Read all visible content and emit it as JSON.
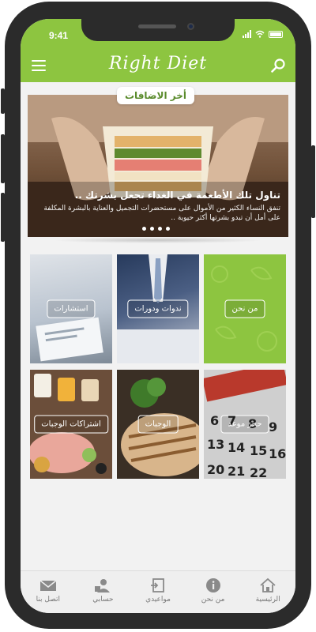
{
  "status_bar": {
    "time": "9:41"
  },
  "header": {
    "title": "Right Diet"
  },
  "featured": {
    "section_label": "أخر الاضافات",
    "slide_title": "تناول تلك الأطعمة في الغداء تجعل بشرتك ..",
    "slide_description": "تنفق النساء الكثير من الأموال على مستحضرات التجميل والعناية بالبشرة المكلفة على أمل أن تبدو بشرتها أكثر حيوية ..",
    "slide_count": 4,
    "active_slide": 1
  },
  "grid": {
    "tiles": [
      {
        "label": "من نحن"
      },
      {
        "label": "ندوات ودورات"
      },
      {
        "label": "استشارات"
      },
      {
        "label": "حجز موعد"
      },
      {
        "label": "الوجبات"
      },
      {
        "label": "اشتراكات الوجبات"
      }
    ]
  },
  "tabbar": {
    "items": [
      {
        "label": "الرئيسية",
        "icon": "home-icon"
      },
      {
        "label": "من نحن",
        "icon": "info-icon"
      },
      {
        "label": "مواعيدي",
        "icon": "appointments-icon"
      },
      {
        "label": "حسابي",
        "icon": "account-icon"
      },
      {
        "label": "اتصل بنا",
        "icon": "envelope-icon"
      }
    ]
  },
  "colors": {
    "accent": "#8dc540",
    "tabbar_bg": "#efefef"
  }
}
